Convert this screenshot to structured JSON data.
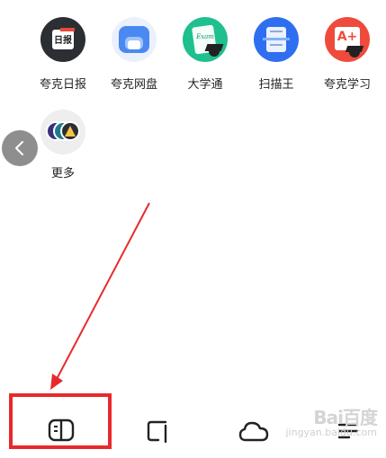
{
  "apps": [
    {
      "label": "夸克日报",
      "icon": "daily-news-icon",
      "icon_text": "日报"
    },
    {
      "label": "夸克网盘",
      "icon": "cloud-drive-icon"
    },
    {
      "label": "大学通",
      "icon": "university-icon",
      "icon_text": "Exam"
    },
    {
      "label": "扫描王",
      "icon": "scanner-icon"
    },
    {
      "label": "夸克学习",
      "icon": "study-icon",
      "icon_text": "A+"
    }
  ],
  "more": {
    "label": "更多",
    "icon": "more-apps-icon"
  },
  "colors": {
    "highlight": "#e8292b",
    "daily_bg": "#2b2e33",
    "drive_bg": "#4a88f2",
    "uni_bg": "#1fbf8f",
    "scan_bg": "#2f6ef0",
    "study_bg": "#ef4b3c"
  },
  "bottom_bar": [
    {
      "name": "bookmarks",
      "icon": "book-icon"
    },
    {
      "name": "tabs",
      "icon": "tabs-icon"
    },
    {
      "name": "cloud",
      "icon": "cloud-icon"
    },
    {
      "name": "menu",
      "icon": "menu-icon"
    }
  ],
  "watermark": {
    "brand": "Bai百度",
    "sub": "jingyan.baidu.com"
  }
}
